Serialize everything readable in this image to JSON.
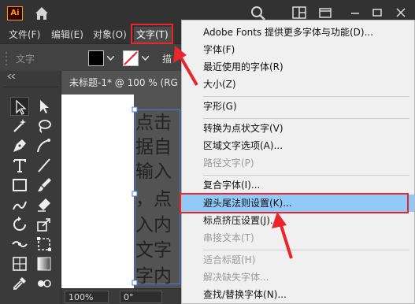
{
  "app": {
    "logo_text": "Ai",
    "icons": [
      "home-icon",
      "search-icon",
      "arrange-documents-icon",
      "workspace-icon",
      "minimize-icon",
      "restore-icon",
      "close-icon"
    ]
  },
  "menubar": {
    "items": [
      {
        "label": "文件(F)"
      },
      {
        "label": "编辑(E)"
      },
      {
        "label": "对象(O)"
      },
      {
        "label": "文字(T)"
      }
    ]
  },
  "controlbar": {
    "label": "文字",
    "partial": "描"
  },
  "document": {
    "tab_title": "未标题-1* @ 100 % (RG"
  },
  "canvas": {
    "lines": [
      "点击",
      "据自",
      "输入",
      "，点",
      "入内",
      "文字",
      "字内"
    ]
  },
  "statusbar": {
    "zoom": "100%",
    "rotation": "0°"
  },
  "dropdown": {
    "items": [
      {
        "label": "Adobe Fonts 提供更多字体与功能(D)...",
        "disabled": false
      },
      {
        "label": "字体(F)",
        "disabled": false
      },
      {
        "label": "最近使用的字体(R)",
        "disabled": false
      },
      {
        "label": "大小(Z)",
        "disabled": false
      },
      {
        "label": "字形(G)",
        "disabled": false
      },
      {
        "label": "转换为点状文字(V)",
        "disabled": false
      },
      {
        "label": "区域文字选项(A)...",
        "disabled": false
      },
      {
        "label": "路径文字(P)",
        "disabled": true
      },
      {
        "label": "复合字体(I)...",
        "disabled": false
      },
      {
        "label": "避头尾法则设置(K)...",
        "disabled": false,
        "highlighted": true
      },
      {
        "label": "标点挤压设置(J)...",
        "disabled": false
      },
      {
        "label": "串接文本(T)",
        "disabled": true
      },
      {
        "label": "适合标题(H)",
        "disabled": true
      },
      {
        "label": "解决缺失字体...",
        "disabled": true
      },
      {
        "label": "查找/替换字体(N)...",
        "disabled": false
      }
    ]
  },
  "colors": {
    "accent_red": "#e8262b",
    "menu_highlight": "#91c9f7",
    "selection_blue": "#4a7fd9"
  }
}
